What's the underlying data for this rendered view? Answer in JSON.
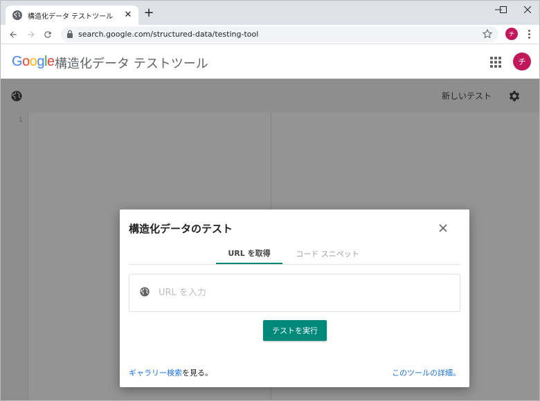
{
  "browser": {
    "tab_title": "構造化データ テストツール",
    "tab_close": "✕",
    "new_tab": "+",
    "url": "search.google.com/structured-data/testing-tool",
    "profile_initial": "チ"
  },
  "header": {
    "logo_letters": [
      {
        "ch": "G",
        "color": "#4285F4"
      },
      {
        "ch": "o",
        "color": "#EA4335"
      },
      {
        "ch": "o",
        "color": "#FBBC05"
      },
      {
        "ch": "g",
        "color": "#4285F4"
      },
      {
        "ch": "l",
        "color": "#34A853"
      },
      {
        "ch": "e",
        "color": "#EA4335"
      }
    ],
    "app_title": "構造化データ テストツール",
    "avatar_initial": "チ",
    "avatar_color": "#c2185b"
  },
  "toolstrip": {
    "new_test_label": "新しいテスト"
  },
  "editor": {
    "line_number": "1"
  },
  "dialog": {
    "title": "構造化データのテスト",
    "tabs": [
      {
        "label": "URL を取得",
        "active": true
      },
      {
        "label": "コード スニペット",
        "active": false
      }
    ],
    "url_placeholder": "URL を入力",
    "run_button_label": "テストを実行",
    "accent_color": "#00897b",
    "footer_link": "ギャラリー検索",
    "footer_suffix": "を見る。",
    "details_link": "このツールの詳細。"
  }
}
